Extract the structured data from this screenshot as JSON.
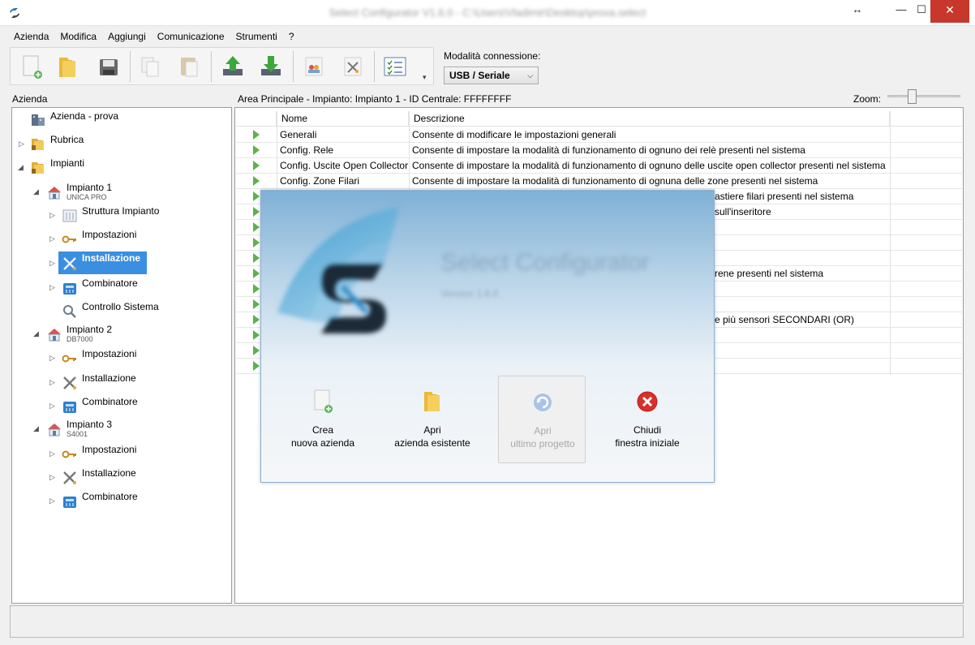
{
  "window": {
    "title": "Select Configurator V1.6.0 - C:\\Users\\Vladimir\\Desktop\\prova.select",
    "app_icon": "select-logo-icon",
    "resize_glyph": "↔",
    "minimize_glyph": "—",
    "maximize_glyph": "☐",
    "close_glyph": "✕"
  },
  "menu": [
    "Azienda",
    "Modifica",
    "Aggiungi",
    "Comunicazione",
    "Strumenti",
    "?"
  ],
  "toolbar": {
    "buttons": [
      "new-document-icon",
      "open-folder-icon",
      "save-disk-icon",
      "copy-icon",
      "paste-icon",
      "upload-icon",
      "download-icon",
      "people-icon",
      "tools-icon",
      "checklist-icon"
    ],
    "more_glyph": "▾"
  },
  "connection": {
    "label": "Modalità connessione:",
    "value": "USB / Seriale",
    "arrow": "⌵"
  },
  "left_panel": {
    "title": "Azienda",
    "tree": {
      "azienda": "Azienda - prova",
      "rubrica": "Rubrica",
      "impianti": "Impianti",
      "impianto1": {
        "label": "Impianto 1",
        "model": "UNICA PRO",
        "children": [
          "Struttura Impianto",
          "Impostazioni",
          "Installazione",
          "Combinatore",
          "Controllo Sistema"
        ]
      },
      "impianto2": {
        "label": "Impianto 2",
        "model": "DB7000",
        "children": [
          "Impostazioni",
          "Installazione",
          "Combinatore"
        ]
      },
      "impianto3": {
        "label": "Impianto 3",
        "model": "S4001",
        "children": [
          "Impostazioni",
          "Installazione",
          "Combinatore"
        ]
      }
    },
    "expanded_glyph": "◢",
    "collapsed_glyph": "▷"
  },
  "main": {
    "header": "Area Principale - Impianto: Impianto 1 - ID Centrale: FFFFFFFF",
    "zoom_label": "Zoom:",
    "zoom_level": 0.3,
    "columns": [
      "Nome",
      "Descrizione"
    ],
    "rows": [
      {
        "nome": "Generali",
        "descrizione": "Consente di modificare le impostazioni generali"
      },
      {
        "nome": "Config. Rele",
        "descrizione": "Consente di impostare la modalità di funzionamento di ognuno dei relè presenti nel sistema"
      },
      {
        "nome": "Config. Uscite Open Collector",
        "descrizione": "Consente di impostare la modalità di funzionamento di ognuno delle uscite open collector presenti nel sistema"
      },
      {
        "nome": "Config. Zone Filari",
        "descrizione": "Consente di impostare la modalità di funzionamento di ognuna delle zone presenti nel sistema"
      }
    ],
    "partial_rows": [
      "astiere filari presenti nel sistema",
      "sull'inseritore",
      "",
      "",
      "",
      "rene presenti nel sistema",
      "",
      "",
      "e più sensori SECONDARI (OR)",
      "",
      "",
      ""
    ]
  },
  "splash": {
    "title": "Select Configurator",
    "version": "Version 1.6.0",
    "actions": [
      {
        "line1": "Crea",
        "line2": "nuova azienda",
        "icon": "new-document-icon",
        "enabled": true
      },
      {
        "line1": "Apri",
        "line2": "azienda esistente",
        "icon": "open-folder-icon",
        "enabled": true
      },
      {
        "line1": "Apri",
        "line2": "ultimo progetto",
        "icon": "recent-refresh-icon",
        "enabled": false
      },
      {
        "line1": "Chiudi",
        "line2": "finestra iniziale",
        "icon": "close-red-icon",
        "enabled": true
      }
    ]
  },
  "colors": {
    "selection": "#3b8fe0",
    "close_button": "#c7372c",
    "play_arrow": "#5cb34a"
  }
}
